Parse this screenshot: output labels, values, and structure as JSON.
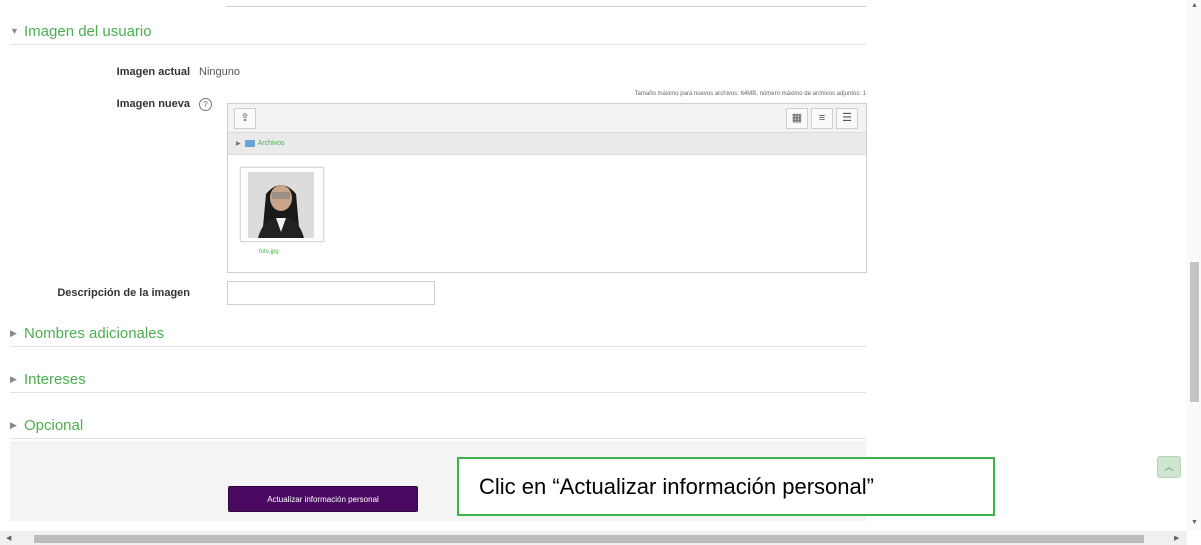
{
  "sections": {
    "user_image": "Imagen del usuario",
    "additional_names": "Nombres adicionales",
    "interests": "Intereses",
    "optional": "Opcional"
  },
  "form": {
    "current_image_label": "Imagen actual",
    "current_image_value": "Ninguno",
    "new_image_label": "Imagen nueva",
    "max_size_text": "Tamaño máximo para nuevos archivos: 64MB, número máximo de archivos adjuntos: 1",
    "description_label": "Descripción de la imagen",
    "description_value": ""
  },
  "filepicker": {
    "path_label": "Archivos",
    "file_name": "foto.jpg",
    "icons": [
      "upload-icon",
      "grid-view-icon",
      "list-view-icon",
      "tree-view-icon",
      "folder-icon"
    ]
  },
  "submit_label": "Actualizar información personal",
  "callout_text": "Clic en “Actualizar información personal”",
  "colors": {
    "section_title": "#4caf50",
    "submit_bg": "#4a0a62",
    "callout_border": "#3cb44b"
  }
}
